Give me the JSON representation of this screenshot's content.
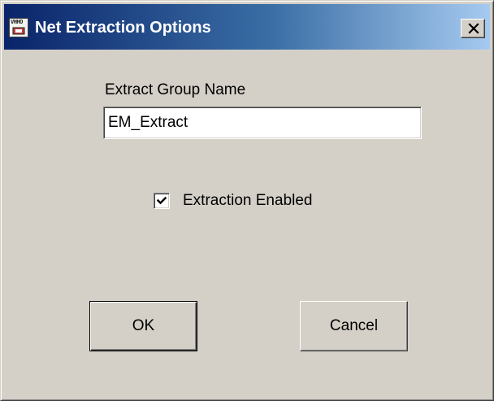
{
  "window": {
    "title": "Net Extraction Options",
    "app_icon": "vhdl-app-icon",
    "app_icon_text": "VHHO",
    "close_icon": "close-icon"
  },
  "form": {
    "group_name_label": "Extract Group Name",
    "group_name_value": "EM_Extract",
    "extraction_enabled_label": "Extraction Enabled",
    "extraction_enabled_checked": true
  },
  "buttons": {
    "ok_label": "OK",
    "cancel_label": "Cancel"
  },
  "colors": {
    "title_gradient_start": "#0a246a",
    "title_gradient_end": "#a6caf0",
    "face": "#d4d0c8"
  }
}
